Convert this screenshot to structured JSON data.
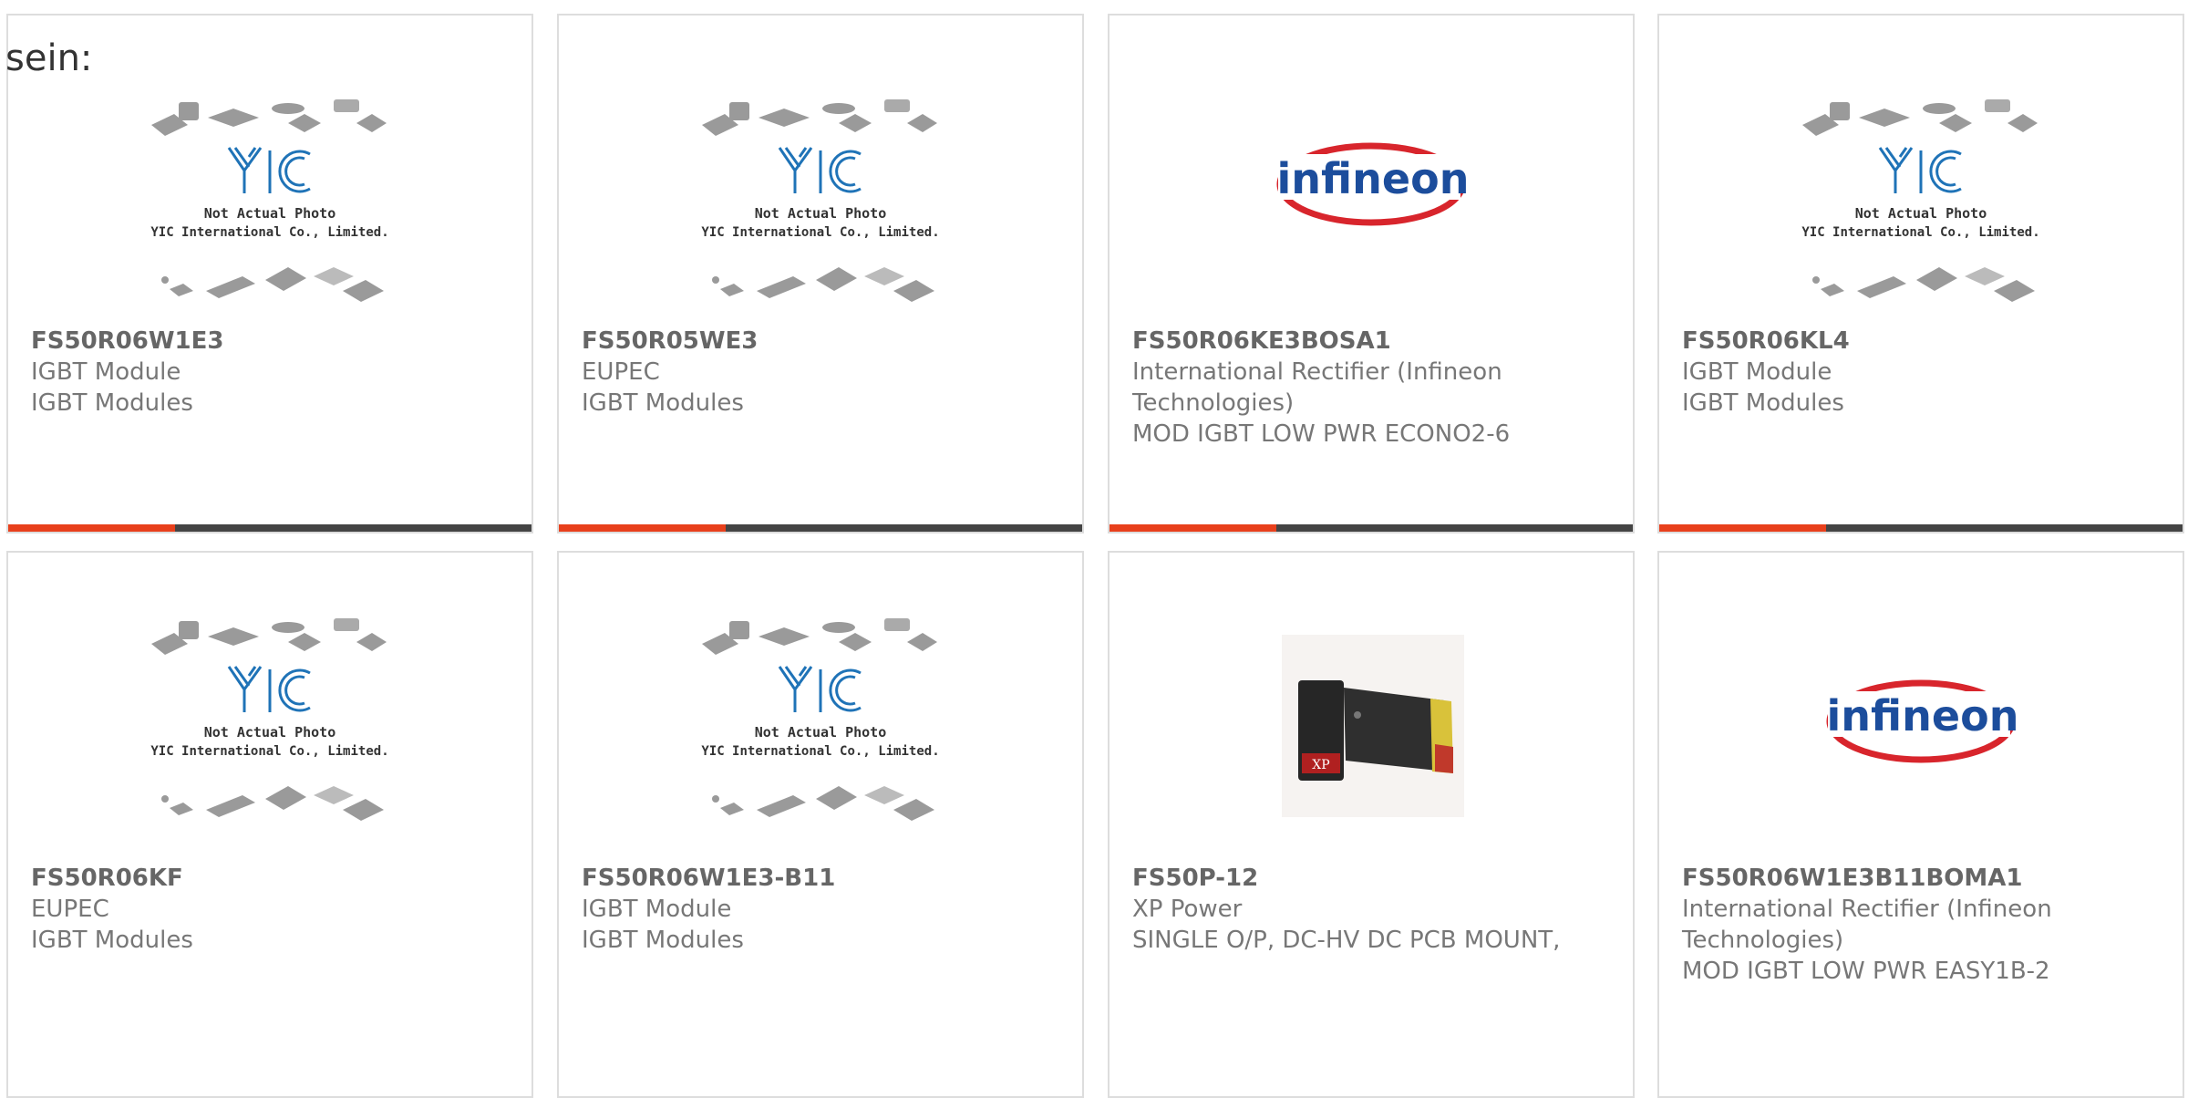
{
  "heading": "sein:",
  "colors": {
    "accent": "#e8401c",
    "bar": "#444444",
    "yic_blue": "#1f73b7",
    "infineon_blue": "#1c4d9c",
    "infineon_red": "#d8252c"
  },
  "placeholder_image": {
    "line1": "Not Actual Photo",
    "line2": "YIC International Co., Limited.",
    "logo": "YIC"
  },
  "infineon_logo": "infineon",
  "products": [
    {
      "part_number": "FS50R06W1E3",
      "manufacturer": "IGBT Module",
      "description": "IGBT Modules",
      "image": "yic-placeholder-icon"
    },
    {
      "part_number": "FS50R05WE3",
      "manufacturer": "EUPEC",
      "description": "IGBT Modules",
      "image": "yic-placeholder-icon"
    },
    {
      "part_number": "FS50R06KE3BOSA1",
      "manufacturer": "International Rectifier (Infineon Technologies)",
      "description": "MOD IGBT LOW PWR ECONO2-6",
      "image": "infineon-logo-icon"
    },
    {
      "part_number": "FS50R06KL4",
      "manufacturer": "IGBT Module",
      "description": "IGBT Modules",
      "image": "yic-placeholder-icon"
    },
    {
      "part_number": "FS50R06KF",
      "manufacturer": "EUPEC",
      "description": "IGBT Modules",
      "image": "yic-placeholder-icon"
    },
    {
      "part_number": "FS50R06W1E3-B11",
      "manufacturer": "IGBT Module",
      "description": "IGBT Modules",
      "image": "yic-placeholder-icon"
    },
    {
      "part_number": "FS50P-12",
      "manufacturer": "XP Power",
      "description": "SINGLE O/P, DC-HV DC PCB MOUNT,",
      "image": "power-module-photo"
    },
    {
      "part_number": "FS50R06W1E3B11BOMA1",
      "manufacturer": "International Rectifier (Infineon Technologies)",
      "description": "MOD IGBT LOW PWR EASY1B-2",
      "image": "infineon-logo-icon"
    }
  ]
}
